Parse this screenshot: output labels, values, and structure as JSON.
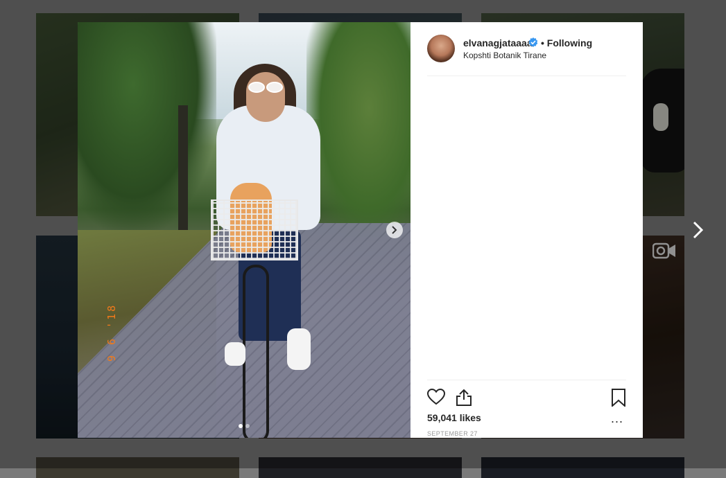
{
  "post": {
    "username": "elvanagjataaaa",
    "follow_status": "Following",
    "separator": "•",
    "location": "Kopshti Botanik Tirane",
    "likes": "59,041 likes",
    "date": "SEPTEMBER 27",
    "more_label": "...",
    "photo_date_stamp": "9 6 '18",
    "carousel": {
      "count": 2,
      "active_index": 0
    }
  },
  "icons": {
    "like": "heart-icon",
    "share": "share-icon",
    "save": "bookmark-icon",
    "verified": "verified-badge-icon",
    "next": "chevron-right-icon",
    "video": "video-camera-icon"
  },
  "colors": {
    "text": "#262626",
    "muted": "#999999",
    "verified": "#3897f0",
    "date_stamp": "#f27a1a"
  }
}
